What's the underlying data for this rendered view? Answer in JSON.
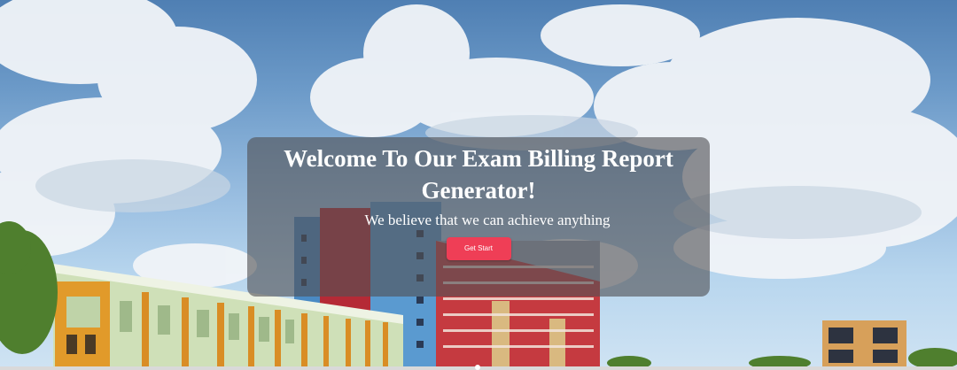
{
  "hero": {
    "title": "Welcome To Our Exam Billing Report Generator!",
    "subtitle": "We believe that we can achieve anything",
    "cta_label": "Get Start"
  },
  "colors": {
    "cta_background": "#ef3e56",
    "overlay": "rgba(80,80,84,0.62)",
    "text": "#ffffff"
  }
}
